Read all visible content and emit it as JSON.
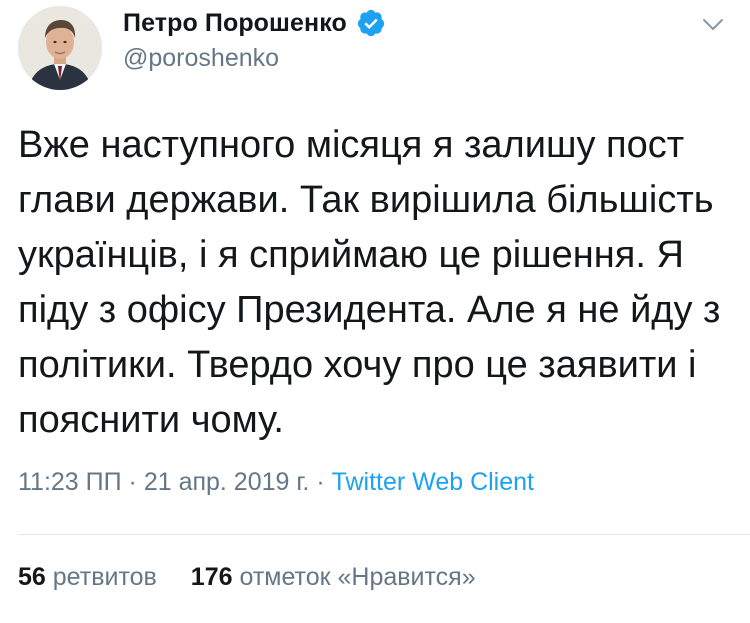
{
  "tweet": {
    "author_name": "Петро Порошенко",
    "author_handle": "@poroshenko",
    "verified": true,
    "text": "Вже наступного місяця я залишу пост глави держави. Так вирішила більшість українців, і я сприймаю це рішення. Я піду з офісу Президента. Але я не йду з політики. Твердо хочу про це заявити і пояснити чому.",
    "time": "11:23 ПП",
    "sep1": " · ",
    "date": "21 апр. 2019 г.",
    "sep2": " · ",
    "client": "Twitter Web Client",
    "retweets_count": "56",
    "retweets_label": "ретвитов",
    "likes_count": "176",
    "likes_label": "отметок «Нравится»"
  },
  "icons": {
    "verified": "verified-badge-icon",
    "menu": "chevron-down-icon"
  },
  "colors": {
    "text": "#14171a",
    "secondary": "#657786",
    "link": "#1da1f2",
    "divider": "#e1e8ed",
    "verified_badge": "#1da1f2"
  }
}
